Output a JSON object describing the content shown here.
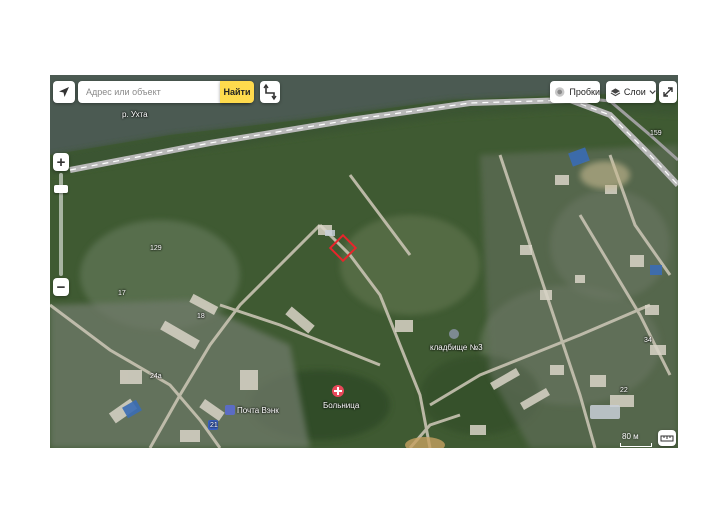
{
  "search": {
    "placeholder": "Адрес или объект",
    "button_label": "Найти"
  },
  "controls": {
    "traffic_label": "Пробки",
    "layers_label": "Слои",
    "zoom_in": "+",
    "zoom_out": "−"
  },
  "map": {
    "labels": {
      "river": "р. Ухта",
      "cemetery": "кладбище №3",
      "hospital": "Больница",
      "post_office": "Почта Вэнк",
      "house_129": "129",
      "house_17": "17",
      "house_18": "18",
      "house_24a": "24а",
      "house_21": "21",
      "house_159": "159",
      "house_22": "22",
      "house_34": "34"
    },
    "scale_label": "80 м",
    "colors": {
      "river": "#4b5a52",
      "railway": "#b9b9b9",
      "marker": "#e8252b",
      "vegetation": "#3f5a32"
    }
  }
}
